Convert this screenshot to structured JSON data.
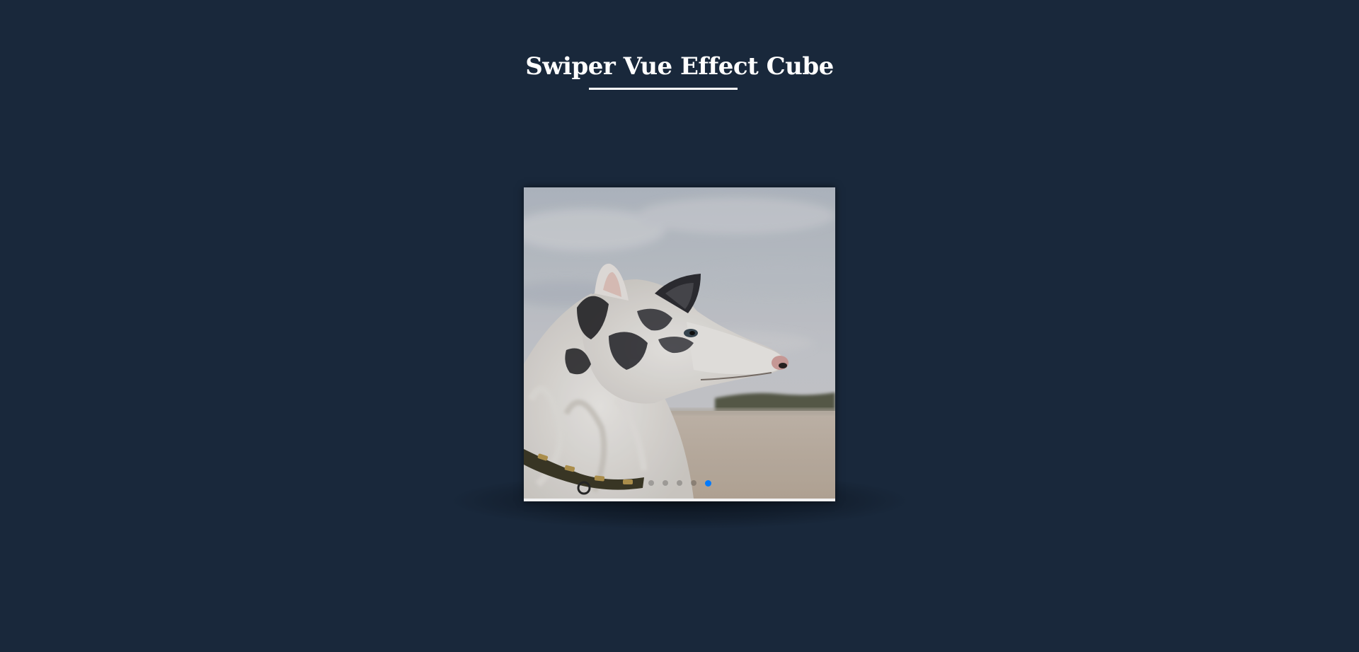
{
  "page": {
    "title": "Swiper Vue Effect Cube",
    "background_color": "#19283b"
  },
  "swiper": {
    "slide_count": 5,
    "active_index": 4,
    "active_slide_image": "white-merle-dog-profile-photo",
    "pagination": {
      "active_color": "#007aff",
      "bullets": [
        {
          "active": false
        },
        {
          "active": false
        },
        {
          "active": false
        },
        {
          "active": false
        },
        {
          "active": true
        }
      ]
    }
  }
}
